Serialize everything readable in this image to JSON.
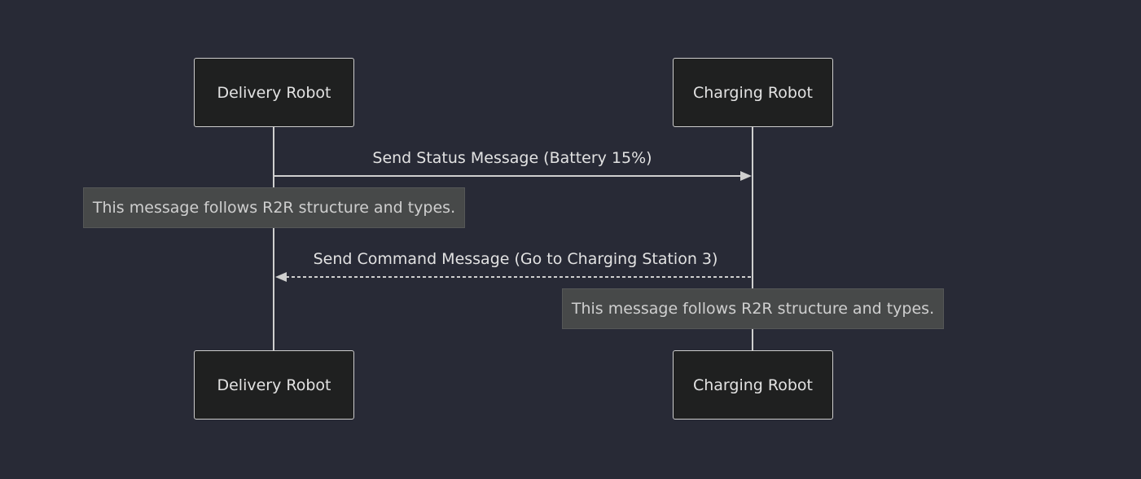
{
  "diagram": {
    "type": "sequence",
    "participants": [
      {
        "id": "delivery",
        "label": "Delivery Robot"
      },
      {
        "id": "charging",
        "label": "Charging Robot"
      }
    ],
    "messages": [
      {
        "from": "delivery",
        "to": "charging",
        "style": "solid",
        "label": "Send Status Message (Battery 15%)"
      },
      {
        "from": "charging",
        "to": "delivery",
        "style": "dashed",
        "label": "Send Command Message (Go to Charging Station 3)"
      }
    ],
    "notes": [
      {
        "over": "delivery",
        "text": "This message follows R2R structure and types."
      },
      {
        "over": "charging",
        "text": "This message follows R2R structure and types."
      }
    ]
  },
  "colors": {
    "background": "#282a36",
    "actor_fill": "#1f2020",
    "actor_border": "#cccccc",
    "line": "#cfcfcf",
    "note_fill": "#474949",
    "text": "#e2e2e2"
  }
}
